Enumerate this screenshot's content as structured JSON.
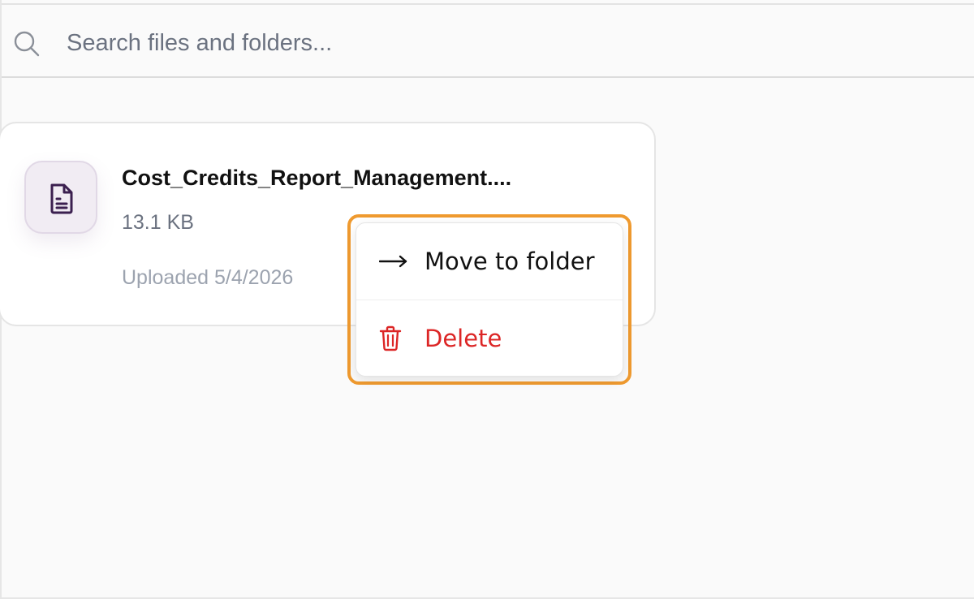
{
  "search": {
    "placeholder": "Search files and folders..."
  },
  "file": {
    "name": "Cost_Credits_Report_Management....",
    "size": "13.1 KB",
    "uploaded": "Uploaded 5/4/2026",
    "icon": "document-icon"
  },
  "context_menu": {
    "items": [
      {
        "label": "Move to folder",
        "icon": "arrow-right-icon"
      },
      {
        "label": "Delete",
        "icon": "trash-icon"
      }
    ]
  },
  "colors": {
    "highlight": "#ef9a2f",
    "danger": "#dc2626",
    "file_icon_bg": "#f1ecf3",
    "file_icon_fg": "#3b1f4f"
  }
}
